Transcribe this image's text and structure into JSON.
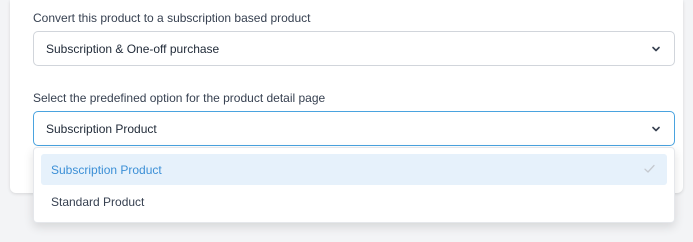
{
  "subscription_type": {
    "label": "Convert this product to a subscription based product",
    "selected": "Subscription & One-off purchase"
  },
  "predefined_option": {
    "label": "Select the predefined option for the product detail page",
    "selected": "Subscription Product",
    "options": [
      {
        "label": "Subscription Product",
        "selected": true
      },
      {
        "label": "Standard Product",
        "selected": false
      }
    ]
  },
  "colors": {
    "focus_border": "#4aa3df",
    "selected_option_bg": "#e6f1fb",
    "selected_option_text": "#3b8fd6"
  },
  "icons": {
    "dropdown": "chevron-down-icon",
    "selected": "checkmark-icon"
  }
}
